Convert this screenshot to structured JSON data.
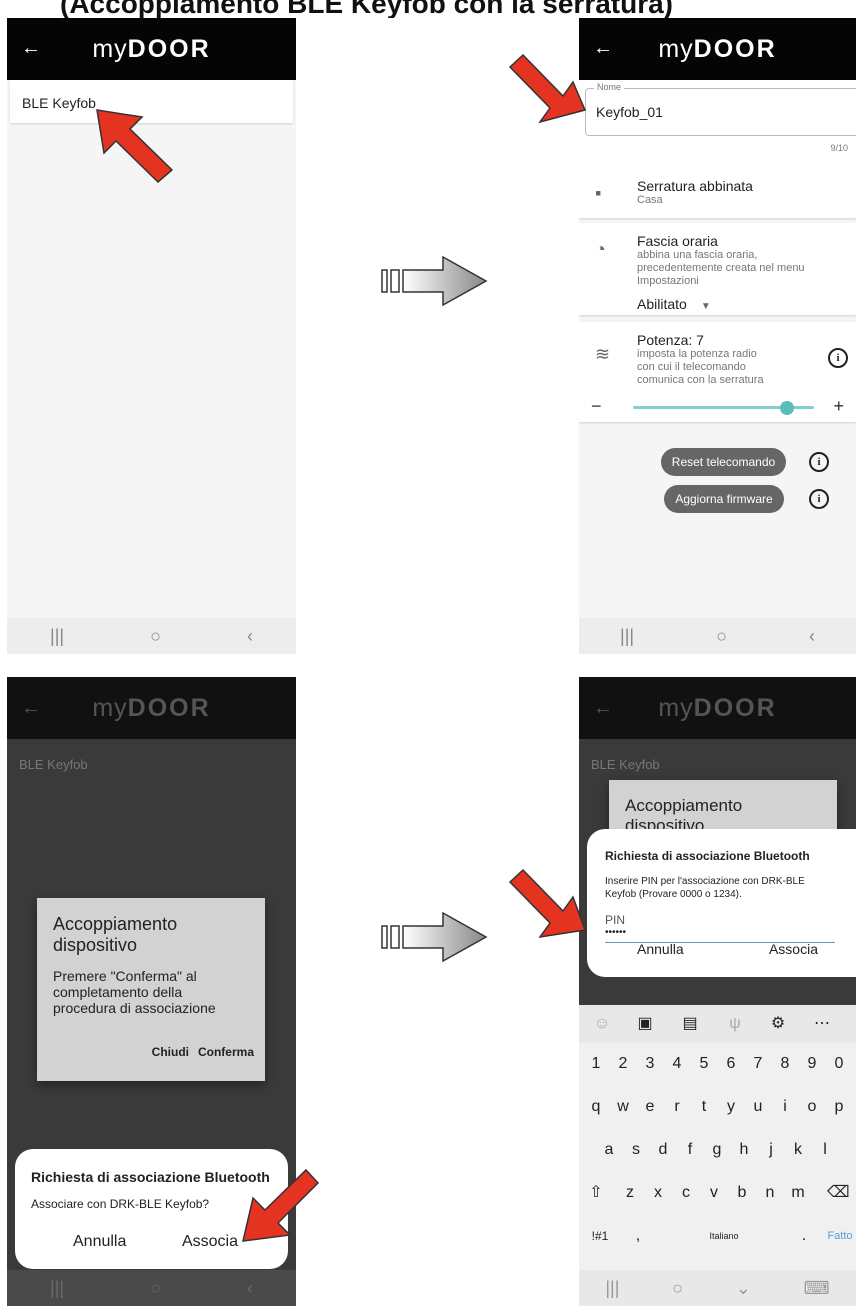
{
  "header_cut": "(Accoppiamento BLE Keyfob con la serratura)",
  "app": {
    "logo_my": "my",
    "logo_door": "DOOR"
  },
  "panel1": {
    "list_item": "BLE Keyfob"
  },
  "panel2": {
    "name_legend": "Nome",
    "name_value": "Keyfob_01",
    "name_counter": "9/10",
    "lock_title": "Serratura abbinata",
    "lock_sub": "Casa",
    "time_title": "Fascia oraria",
    "time_sub": "abbina una fascia oraria, precedentemente creata nel menu Impostazioni",
    "time_value": "Abilitato",
    "power_title": "Potenza: 7",
    "power_sub": "imposta la potenza radio con cui il telecomando comunica con la serratura",
    "power_level": 0.85,
    "reset_label": "Reset telecomando",
    "firmware_label": "Aggiorna firmware"
  },
  "panel3": {
    "bg_item": "BLE Keyfob",
    "dlg_title": "Accoppiamento dispositivo",
    "dlg_body": "Premere \"Conferma\" al completamento della procedura di associazione",
    "btn_close": "Chiudi",
    "btn_confirm": "Conferma",
    "bt_title": "Richiesta di associazione Bluetooth",
    "bt_body": "Associare con DRK-BLE Keyfob?",
    "bt_cancel": "Annulla",
    "bt_pair": "Associa"
  },
  "panel4": {
    "bg_item": "BLE Keyfob",
    "dlg_title": "Accoppiamento dispositivo",
    "bt_title": "Richiesta di associazione Bluetooth",
    "bt_body": "Inserire PIN per l'associazione con DRK-BLE Keyfob (Provare 0000 o 1234).",
    "pin_label": "PIN",
    "pin_value": "••••••",
    "bt_cancel": "Annulla",
    "bt_pair": "Associa",
    "kb_row1": [
      "1",
      "2",
      "3",
      "4",
      "5",
      "6",
      "7",
      "8",
      "9",
      "0"
    ],
    "kb_row2": [
      "q",
      "w",
      "e",
      "r",
      "t",
      "y",
      "u",
      "i",
      "o",
      "p"
    ],
    "kb_row3": [
      "a",
      "s",
      "d",
      "f",
      "g",
      "h",
      "j",
      "k",
      "l"
    ],
    "kb_row4": [
      "z",
      "x",
      "c",
      "v",
      "b",
      "n",
      "m"
    ],
    "kb_sym": "!#1",
    "kb_comma": ",",
    "kb_space": "Italiano",
    "kb_dot": ".",
    "kb_done": "Fatto"
  },
  "colors": {
    "accent": "#5bbcbc",
    "arrow_red": "#e53322",
    "dim_bg": "#3a3a3a"
  },
  "icons": [
    "back-arrow-icon",
    "door-icon",
    "clock-icon",
    "wifi-icon",
    "info-icon",
    "shift-icon",
    "backspace-icon",
    "flow-arrow-icon",
    "pointer-arrow-icon"
  ]
}
